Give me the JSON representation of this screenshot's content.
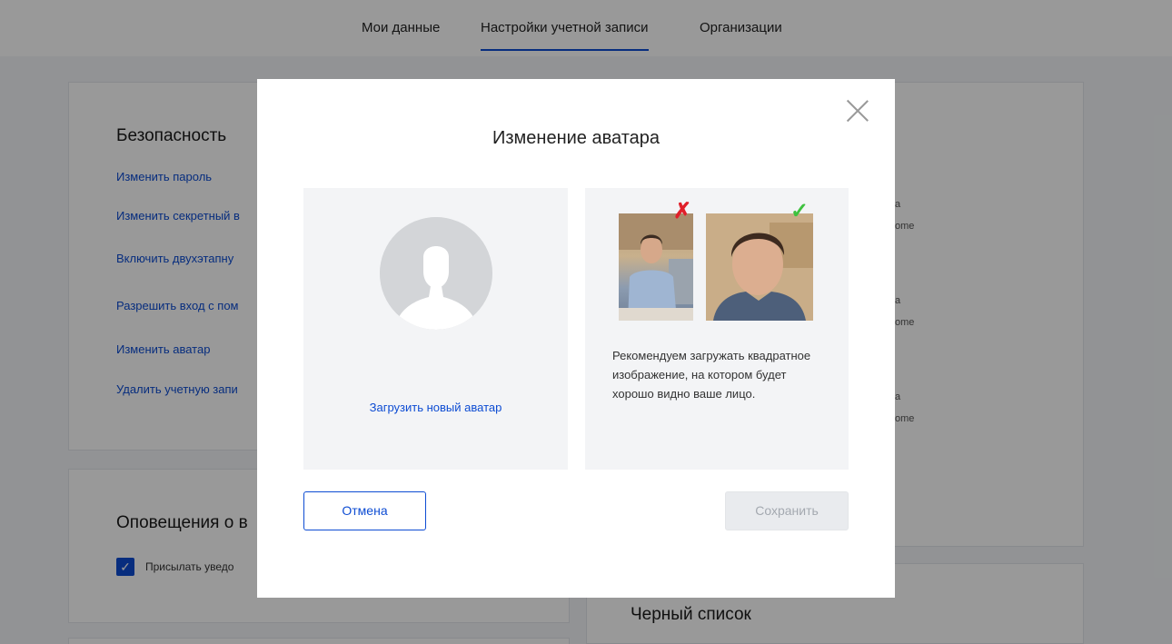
{
  "nav": {
    "tabs": [
      "Мои данные",
      "Настройки учетной записи",
      "Организации"
    ],
    "active_index": 1
  },
  "security": {
    "title": "Безопасность",
    "links": [
      "Изменить пароль",
      "Изменить секретный в",
      "Включить двухэтапну",
      "Разрешить вход с пом",
      "Изменить аватар",
      "Удалить учетную запи"
    ]
  },
  "right_card": {
    "snippets": [
      "а",
      "ome",
      "а",
      "ome",
      "а",
      "ome"
    ]
  },
  "notifications": {
    "title": "Оповещения о в",
    "checkbox_label": "Присылать уведо",
    "checked": true
  },
  "blacklist": {
    "title": "Черный список"
  },
  "modal": {
    "title": "Изменение аватара",
    "upload_link": "Загрузить новый аватар",
    "recommendation": "Рекомендуем загружать квадратное изображение, на котором будет хорошо видно ваше лицо.",
    "cancel": "Отмена",
    "save": "Сохранить"
  },
  "colors": {
    "accent": "#0d4cd3",
    "bad_mark": "#e0202a",
    "good_mark": "#3ec13e"
  },
  "icons": [
    "close-icon",
    "avatar-placeholder-icon",
    "cross-mark-icon",
    "check-mark-icon",
    "checkbox-checked-icon"
  ]
}
